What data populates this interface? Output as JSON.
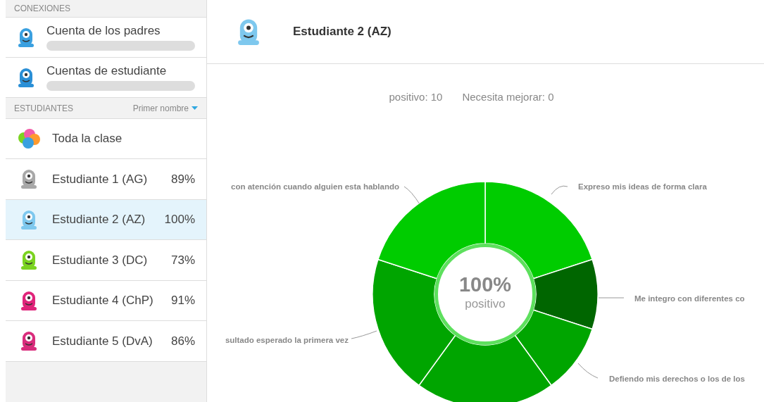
{
  "sidebar": {
    "connections_header": "CONEXIONES",
    "connections": [
      {
        "label": "Cuenta de los padres"
      },
      {
        "label": "Cuentas de estudiante"
      }
    ],
    "students_header": "ESTUDIANTES",
    "sort": {
      "label": "Primer nombre"
    },
    "whole_class": {
      "label": "Toda la clase"
    },
    "students": [
      {
        "name": "Estudiante 1 (AG)",
        "score": "89%",
        "selected": false,
        "color": "#a8a8a8"
      },
      {
        "name": "Estudiante 2 (AZ)",
        "score": "100%",
        "selected": true,
        "color": "#7ec8ee"
      },
      {
        "name": "Estudiante 3 (DC)",
        "score": "73%",
        "selected": false,
        "color": "#7bd321"
      },
      {
        "name": "Estudiante 4 (ChP)",
        "score": "91%",
        "selected": false,
        "color": "#e0247a"
      },
      {
        "name": "Estudiante 5 (DvA)",
        "score": "86%",
        "selected": false,
        "color": "#d92c7c"
      }
    ]
  },
  "header": {
    "title": "Estudiante 2 (AZ)"
  },
  "summary": [
    {
      "label": "positivo:",
      "value": "10"
    },
    {
      "label": "Necesita mejorar:",
      "value": "0"
    }
  ],
  "chart": {
    "center_value": "100%",
    "center_label": "positivo",
    "chart_data": {
      "type": "donut",
      "values": [
        20,
        10,
        10,
        20,
        20,
        20
      ]
    },
    "slices": [
      {
        "color": "#00cc00"
      },
      {
        "color": "#006600"
      },
      {
        "color": "#00a500"
      },
      {
        "color": "#00a500"
      },
      {
        "color": "#00a500"
      },
      {
        "color": "#00cc00"
      }
    ],
    "labels": [
      {
        "text": "con atención cuando alguien esta hablando"
      },
      {
        "text": "Expreso mis ideas de forma clara"
      },
      {
        "text": "Me integro con diferentes co"
      },
      {
        "text": "sultado esperado la primera vez"
      },
      {
        "text": "Defiendo mis derechos o los de los"
      }
    ]
  }
}
